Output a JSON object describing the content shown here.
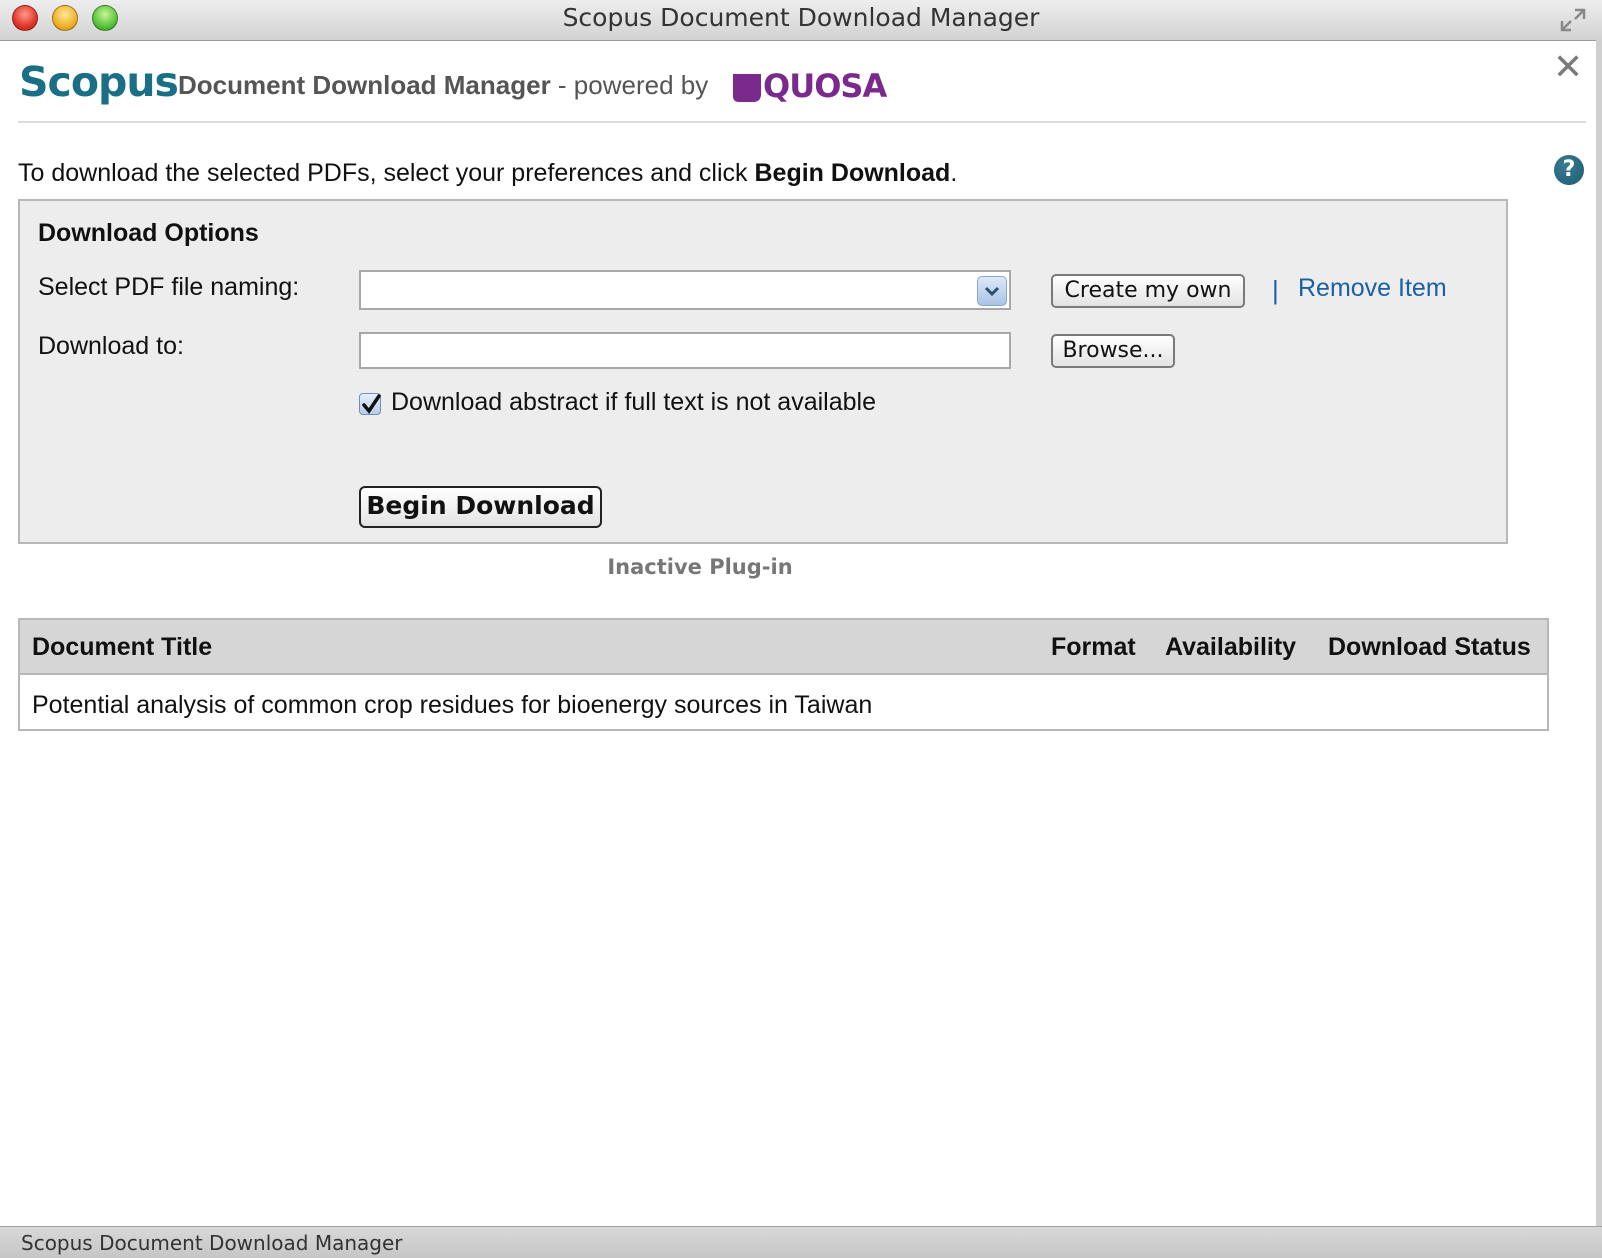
{
  "window": {
    "title": "Scopus Document Download Manager"
  },
  "header": {
    "scopus_logo": "Scopus",
    "title_bold": "Document Download Manager",
    "powered_by": " - powered by",
    "quosa_logo": "QUOSA",
    "close_glyph": "✕"
  },
  "instruction": {
    "prefix": "To download the selected PDFs, select your preferences and click ",
    "bold": "Begin Download",
    "suffix": "."
  },
  "help_icon": "?",
  "options": {
    "title": "Download Options",
    "naming_label": "Select PDF file naming:",
    "naming_value": "",
    "create_button": "Create my own",
    "separator": "|",
    "remove_link": "Remove Item",
    "download_to_label": "Download to:",
    "download_to_value": "",
    "browse_button": "Browse...",
    "abstract_checkbox_label": "Download abstract if full text is not available",
    "abstract_checked": true,
    "begin_button": "Begin Download"
  },
  "plugin_status": "Inactive Plug-in",
  "table": {
    "headers": [
      "Document Title",
      "Format",
      "Availability",
      "Download Status"
    ],
    "rows": [
      [
        "Potential analysis of common crop residues for bioenergy sources in Taiwan",
        "",
        "",
        ""
      ]
    ]
  },
  "statusbar": {
    "text": "Scopus Document Download Manager"
  },
  "colors": {
    "scopus_brand": "#1a6f86",
    "quosa_brand": "#7a2a8c",
    "link": "#1b5fa5",
    "panel_bg": "#ededed"
  }
}
